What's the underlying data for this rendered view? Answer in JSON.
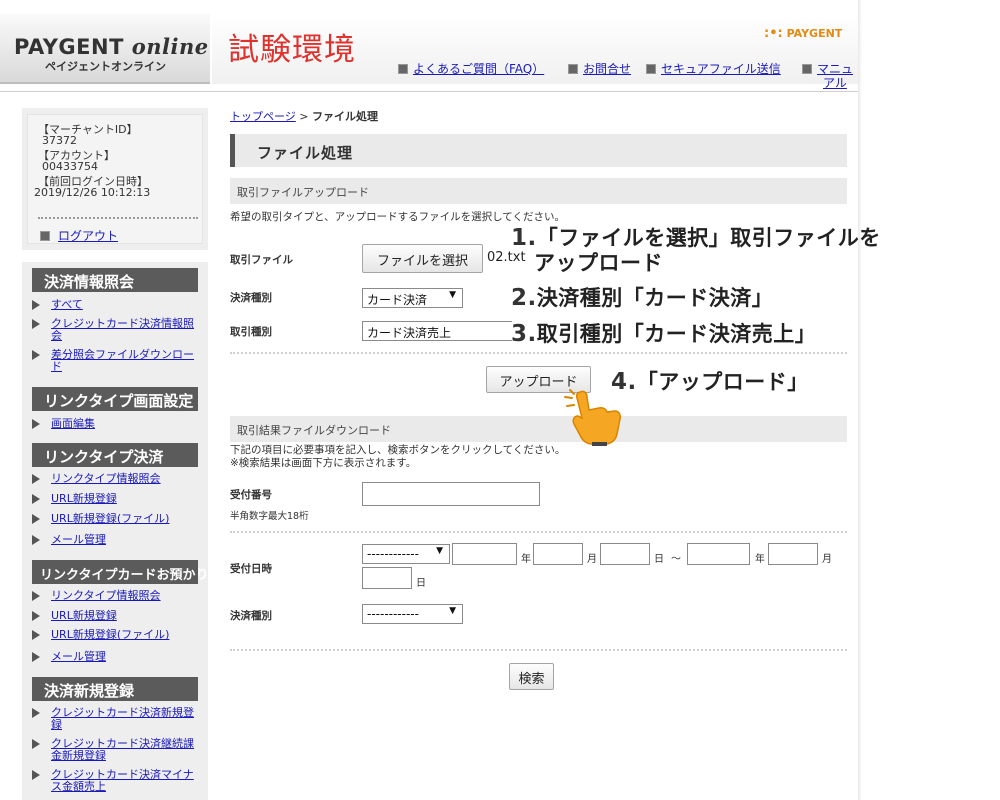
{
  "header": {
    "logo_main": "PAYGENT",
    "logo_online": "online",
    "logo_sub": "ペイジェントオンライン",
    "env_title": "試験環境",
    "brand_dots": ":•:",
    "brand_name": "PAYGENT",
    "nav": [
      {
        "label": "よくあるご質問（FAQ）"
      },
      {
        "label": "お問合せ"
      },
      {
        "label": "セキュアファイル送信"
      },
      {
        "label": "マニュ",
        "label2": "アル"
      }
    ]
  },
  "account": {
    "merchant_id_label": "【マーチャントID】",
    "merchant_id": "37372",
    "account_label": "【アカウント】",
    "account": "00433754",
    "last_login_label": "【前回ログイン日時】",
    "last_login": "2019/12/26 10:12:13",
    "logout": "ログアウト"
  },
  "sidebar": {
    "sections": [
      {
        "title": "決済情報照会",
        "items": [
          "すべて",
          "クレジットカード決済情報照",
          "会",
          "差分照会ファイルダウンロー",
          "ド"
        ]
      },
      {
        "title": "リンクタイプ画面設定",
        "items": [
          "画面編集"
        ]
      },
      {
        "title": "リンクタイプ決済",
        "items": [
          "リンクタイプ情報照会",
          "URL新規登録",
          "URL新規登録(ファイル)",
          "メール管理"
        ]
      },
      {
        "title": "リンクタイプカードお預かり",
        "items": [
          "リンクタイプ情報照会",
          "URL新規登録",
          "URL新規登録(ファイル)",
          "メール管理"
        ]
      },
      {
        "title": "決済新規登録",
        "items": [
          "クレジットカード決済新規登",
          "録",
          "クレジットカード決済継続課",
          "金新規登録",
          "クレジットカード決済マイナ",
          "ス金額売上"
        ]
      }
    ]
  },
  "main": {
    "breadcrumb_home": "トップページ",
    "breadcrumb_sep": " > ",
    "breadcrumb_current": "ファイル処理",
    "page_title": "ファイル処理",
    "upload": {
      "section_title": "取引ファイルアップロード",
      "description": "希望の取引タイプと、アップロードするファイルを選択してください。",
      "file_label": "取引ファイル",
      "file_button": "ファイルを選択",
      "file_name": "02.txt",
      "payment_type_label": "決済種別",
      "payment_type_value": "カード決済",
      "transaction_type_label": "取引種別",
      "transaction_type_value": "カード決済売上",
      "upload_button": "アップロード"
    },
    "download": {
      "section_title": "取引結果ファイルダウンロード",
      "description_1": "下記の項目に必要事項を記入し、検索ボタンをクリックしてください。",
      "description_2": "※検索結果は画面下方に表示されます。",
      "receipt_label": "受付番号",
      "receipt_hint": "半角数字最大18桁",
      "receipt_value": "",
      "date_label": "受付日時",
      "date_select": "------------",
      "year_unit": "年",
      "month_unit": "月",
      "day_unit": "日",
      "tilde": "～",
      "payment_type_label": "決済種別",
      "payment_type_value": "------------",
      "search_button": "検索"
    }
  },
  "annotations": [
    {
      "num": "1.",
      "text": "「ファイルを選択」取引ファイルを",
      "text2": "アップロード"
    },
    {
      "num": "2.",
      "text": "決済種別「カード決済」"
    },
    {
      "num": "3.",
      "text": "取引種別「カード決済売上」"
    },
    {
      "num": "4.",
      "text": "「アップロード」"
    }
  ],
  "colors": {
    "env_title": "#e0322d",
    "brand": "#e38b13",
    "link": "#1a1abb",
    "sidebar_head": "#5b5b5b",
    "pointer": "#f5a623"
  },
  "icons": {
    "nav_bullet": "square-bullet-icon",
    "sidebar_bullet": "triangle-bullet-icon",
    "pointer": "pointing-hand-icon"
  }
}
